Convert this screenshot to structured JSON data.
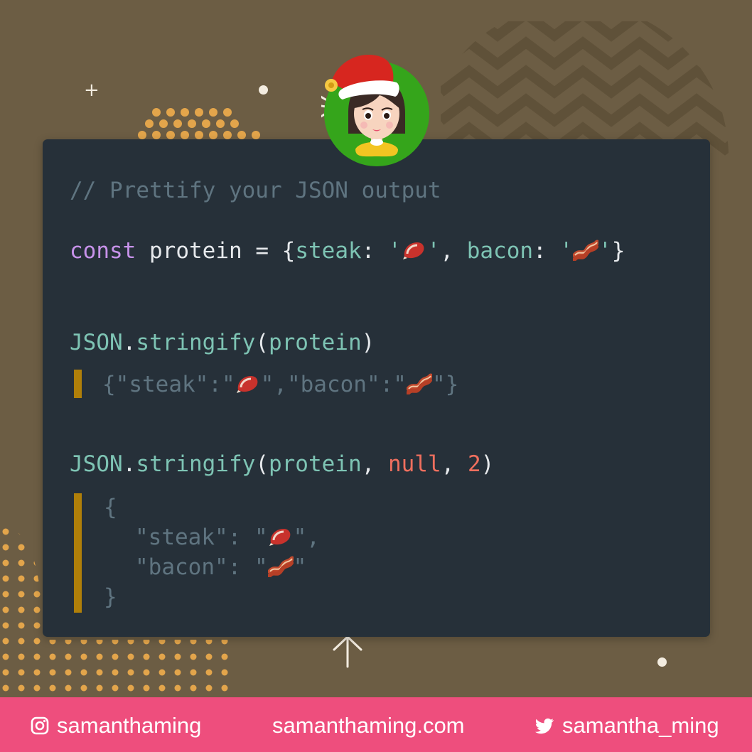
{
  "code": {
    "comment": "// Prettify your JSON output",
    "decl": {
      "keyword": "const",
      "name": "protein",
      "equals": "=",
      "open": "{",
      "steak_key": "steak",
      "colon": ":",
      "quote": "'",
      "comma": ",",
      "bacon_key": "bacon",
      "close": "}"
    },
    "call1": {
      "object": "JSON",
      "dot": ".",
      "method": "stringify",
      "open_paren": "(",
      "arg": "protein",
      "close_paren": ")"
    },
    "output1": {
      "prefix": "{\"steak\":\"",
      "middle": "\",\"bacon\":\"",
      "suffix": "\"}"
    },
    "call2": {
      "object": "JSON",
      "dot": ".",
      "method": "stringify",
      "open_paren": "(",
      "arg": "protein",
      "sep": ",",
      "null_kw": "null",
      "num": "2",
      "close_paren": ")"
    },
    "output2": {
      "open": "{",
      "steak_line_prefix": "\"steak\": \"",
      "steak_line_suffix": "\",",
      "bacon_line_prefix": "\"bacon\": \"",
      "bacon_line_suffix": "\"",
      "close": "}"
    }
  },
  "footer": {
    "instagram": "samanthaming",
    "website": "samanthaming.com",
    "twitter": "samantha_ming"
  },
  "icons": [
    "plus-icon",
    "steak-emoji-icon",
    "bacon-emoji-icon",
    "instagram-icon",
    "twitter-icon",
    "arrow-up-icon"
  ],
  "colors": {
    "background": "#6c5d44",
    "card": "#263039",
    "accent_bar": "#b07f09",
    "footer": "#ee4e7d",
    "keyword": "#c792ea",
    "property": "#7ec4b4",
    "number": "#ef6f5e",
    "comment": "#5f7480"
  }
}
